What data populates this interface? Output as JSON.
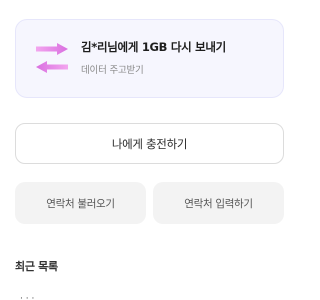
{
  "gift_card": {
    "title": "김*리님에게 1GB 다시 보내기",
    "subtitle": "데이터 주고받기",
    "arrow_color": "#e983e6"
  },
  "charge_button": {
    "label": "나에게 충전하기"
  },
  "contacts": {
    "load_label": "연락처 불러오기",
    "input_label": "연락처 입력하기"
  },
  "recent": {
    "title": "최근 목록",
    "partial_text": "· · ·"
  }
}
